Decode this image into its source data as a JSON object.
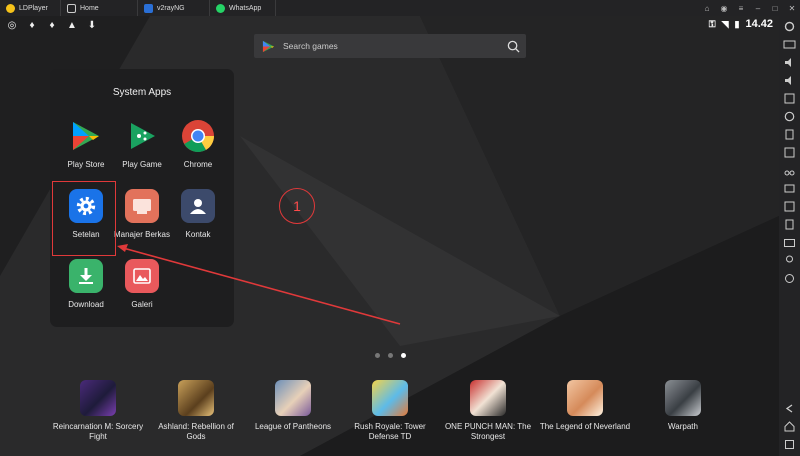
{
  "window": {
    "tabs": [
      {
        "label": "LDPlayer"
      },
      {
        "label": "Home"
      },
      {
        "label": "v2rayNG"
      },
      {
        "label": "WhatsApp"
      }
    ],
    "controls": [
      "help",
      "account",
      "menu",
      "minimize",
      "maximize",
      "close"
    ]
  },
  "status": {
    "time": "14.42",
    "left_icons": [
      "whatsapp-icon",
      "v2ray-icon",
      "v2ray-icon",
      "app-icon",
      "download-icon"
    ]
  },
  "search": {
    "placeholder": "Search games"
  },
  "folder": {
    "title": "System Apps",
    "apps": [
      {
        "label": "Play Store"
      },
      {
        "label": "Play Game"
      },
      {
        "label": "Chrome"
      },
      {
        "label": "Setelan"
      },
      {
        "label": "Manajer Berkas"
      },
      {
        "label": "Kontak"
      },
      {
        "label": "Download"
      },
      {
        "label": "Galeri"
      }
    ]
  },
  "annotation": {
    "step": "1",
    "accent": "#e0393a"
  },
  "pager": {
    "pages": 3,
    "current": 3
  },
  "games": [
    {
      "line1": "Reincarnation M: Sorcery",
      "line2": "Fight"
    },
    {
      "line1": "Ashland: Rebellion of",
      "line2": "Gods"
    },
    {
      "line1": "League of Pantheons",
      "line2": ""
    },
    {
      "line1": "Rush Royale: Tower",
      "line2": "Defense TD"
    },
    {
      "line1": "ONE PUNCH MAN: The",
      "line2": "Strongest"
    },
    {
      "line1": "The Legend of Neverland",
      "line2": ""
    },
    {
      "line1": "Warpath",
      "line2": ""
    }
  ]
}
